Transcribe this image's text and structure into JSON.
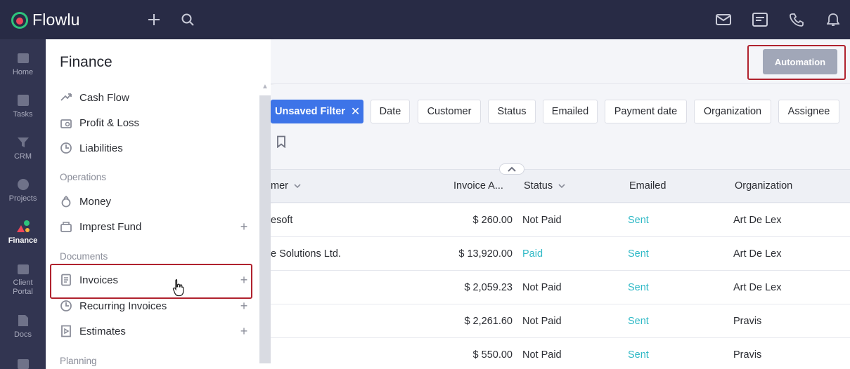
{
  "app": {
    "name": "Flowlu"
  },
  "rail": {
    "items": [
      {
        "label": "Home",
        "icon": "home-icon"
      },
      {
        "label": "Tasks",
        "icon": "tasks-icon"
      },
      {
        "label": "CRM",
        "icon": "crm-icon"
      },
      {
        "label": "Projects",
        "icon": "projects-icon"
      },
      {
        "label": "Finance",
        "icon": "finance-icon",
        "active": true
      },
      {
        "label": "Client Portal",
        "icon": "client-portal-icon"
      },
      {
        "label": "Docs",
        "icon": "docs-icon"
      }
    ]
  },
  "panel": {
    "title": "Finance",
    "items": [
      {
        "label": "Cash Flow",
        "icon": "cash-flow-icon"
      },
      {
        "label": "Profit & Loss",
        "icon": "profit-loss-icon"
      },
      {
        "label": "Liabilities",
        "icon": "liabilities-icon"
      }
    ],
    "sections": {
      "operations": "Operations",
      "documents": "Documents",
      "planning": "Planning"
    },
    "operations_items": [
      {
        "label": "Money",
        "icon": "money-icon"
      },
      {
        "label": "Imprest Fund",
        "icon": "imprest-fund-icon",
        "plus": "+"
      }
    ],
    "documents_items": [
      {
        "label": "Invoices",
        "icon": "invoices-icon",
        "plus": "+"
      },
      {
        "label": "Recurring Invoices",
        "icon": "recurring-invoices-icon",
        "plus": "+"
      },
      {
        "label": "Estimates",
        "icon": "estimates-icon",
        "plus": "+"
      }
    ]
  },
  "toolbar": {
    "automation_label": "Automation"
  },
  "filters": {
    "active_label": "Unsaved Filter",
    "chips": [
      "Date",
      "Customer",
      "Status",
      "Emailed",
      "Payment date",
      "Organization",
      "Assignee"
    ]
  },
  "table": {
    "headers": {
      "customer": "mer",
      "amount": "Invoice A...",
      "status": "Status",
      "emailed": "Emailed",
      "organization": "Organization"
    },
    "rows": [
      {
        "customer": "esoft",
        "amount": "$ 260.00",
        "status": "Not Paid",
        "emailed": "Sent",
        "organization": "Art De Lex"
      },
      {
        "customer": "e Solutions Ltd.",
        "amount": "$ 13,920.00",
        "status": "Paid",
        "emailed": "Sent",
        "organization": "Art De Lex"
      },
      {
        "customer": "",
        "amount": "$ 2,059.23",
        "status": "Not Paid",
        "emailed": "Sent",
        "organization": "Art De Lex"
      },
      {
        "customer": "",
        "amount": "$ 2,261.60",
        "status": "Not Paid",
        "emailed": "Sent",
        "organization": "Pravis"
      },
      {
        "customer": "",
        "amount": "$ 550.00",
        "status": "Not Paid",
        "emailed": "Sent",
        "organization": "Pravis"
      }
    ]
  },
  "colors": {
    "topbar": "#282b45",
    "rail": "#323551",
    "accent": "#3d74e8",
    "highlight": "#b0222e",
    "paid": "#2fb9c6"
  }
}
